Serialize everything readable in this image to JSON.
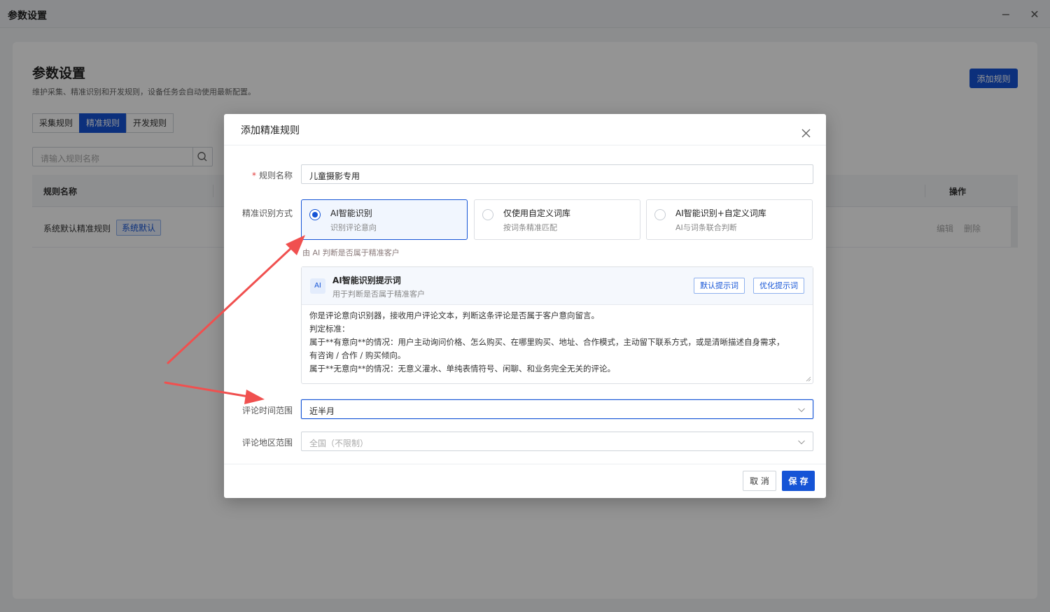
{
  "window": {
    "title": "参数设置",
    "minimize_glyph": "−",
    "close_glyph": "✕"
  },
  "page": {
    "title": "参数设置",
    "description": "维护采集、精准识别和开发规则，设备任务会自动使用最新配置。",
    "add_rule_label": "添加规则",
    "tabs": [
      {
        "label": "采集规则"
      },
      {
        "label": "精准规则"
      },
      {
        "label": "开发规则"
      }
    ],
    "search_placeholder": "请输入规则名称",
    "table": {
      "col_name": "规则名称",
      "col_ops": "操作",
      "rows": [
        {
          "name": "系统默认精准规则",
          "badge": "系统默认",
          "edit": "编辑",
          "delete": "删除"
        }
      ]
    }
  },
  "modal": {
    "title": "添加精准规则",
    "rule_name": {
      "label": "规则名称",
      "value": "儿童摄影专用"
    },
    "mode": {
      "label": "精准识别方式",
      "options": [
        {
          "title": "AI智能识别",
          "subtitle": "识别评论意向",
          "selected": true
        },
        {
          "title": "仅使用自定义词库",
          "subtitle": "按词条精准匹配",
          "selected": false
        },
        {
          "title": "AI智能识别+自定义词库",
          "subtitle": "AI与词条联合判断",
          "selected": false
        }
      ],
      "hint": "由 AI 判断是否属于精准客户"
    },
    "prompt": {
      "badge": "AI",
      "title": "AI智能识别提示词",
      "subtitle": "用于判断是否属于精准客户",
      "default_btn": "默认提示词",
      "optimize_btn": "优化提示词",
      "lines": [
        "你是评论意向识别器，接收用户评论文本，判断这条评论是否属于客户意向留言。",
        "判定标准：",
        "属于**有意向**的情况：用户主动询问价格、怎么购买、在哪里购买、地址、合作模式，主动留下联系方式，或是清晰描述自身需求，",
        "有咨询 / 合作 / 购买倾向。",
        "属于**无意向**的情况：无意义灌水、单纯表情符号、闲聊、和业务完全无关的评论。"
      ]
    },
    "time_range": {
      "label": "评论时间范围",
      "value": "近半月"
    },
    "region": {
      "label": "评论地区范围",
      "placeholder": "全国（不限制）"
    },
    "cancel_label": "取 消",
    "save_label": "保 存"
  },
  "colors": {
    "accent": "#1554d6",
    "annotation_arrow": "#f0504f"
  }
}
